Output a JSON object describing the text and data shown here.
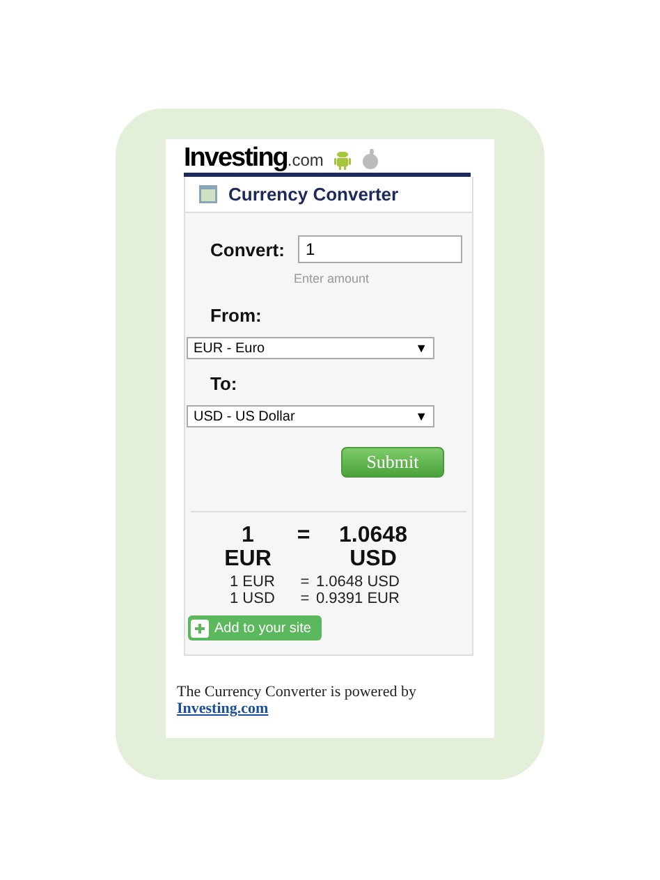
{
  "logo": {
    "name": "Investing",
    "suffix": ".com"
  },
  "widget": {
    "title": "Currency Converter",
    "convert_label": "Convert:",
    "amount": "1",
    "hint": "Enter amount",
    "from_label": "From:",
    "from_value": "EUR - Euro",
    "from_arrow": "▼",
    "to_label": "To:",
    "to_value": "USD - US Dollar",
    "to_arrow": "▼",
    "submit": "Submit",
    "result": {
      "amount": "1",
      "equals": "=",
      "converted": "1.0648",
      "from_code": "EUR",
      "to_code": "USD"
    },
    "rates": [
      {
        "left": "1 EUR",
        "equals": "=",
        "right": "1.0648 USD"
      },
      {
        "left": "1 USD",
        "equals": "=",
        "right": "0.9391 EUR"
      }
    ],
    "add_button": "Add to your site"
  },
  "footer": {
    "text": "The Currency Converter is powered by",
    "link": "Investing.com"
  }
}
